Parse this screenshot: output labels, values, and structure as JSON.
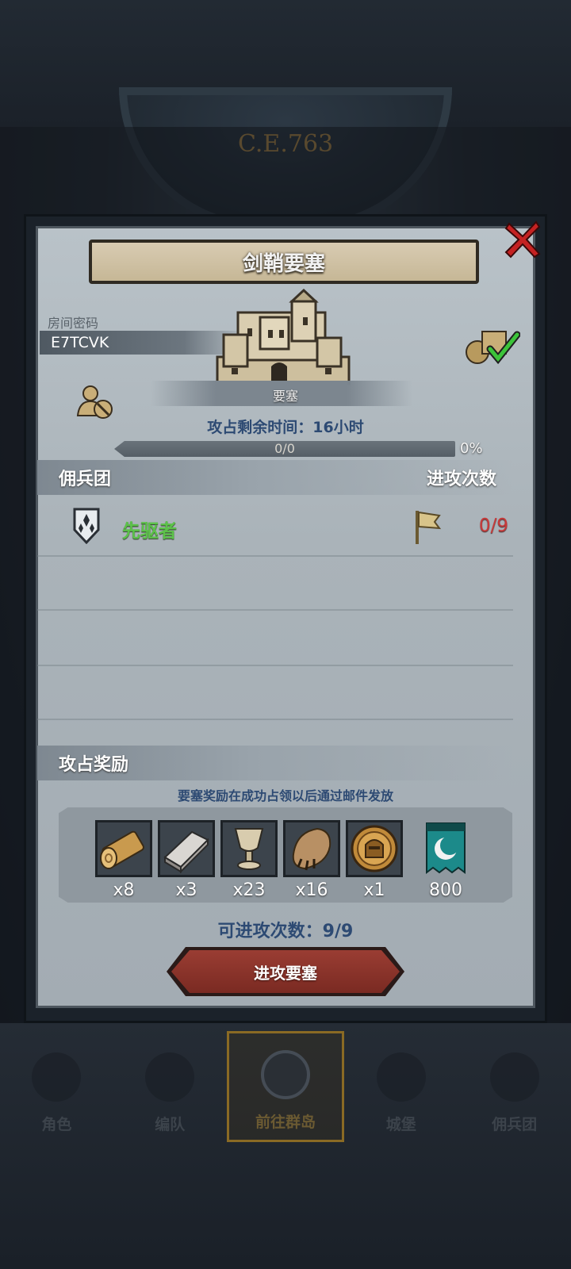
{
  "backdrop": {
    "era": "C.E.763"
  },
  "dialog": {
    "title": "剑鞘要塞",
    "room_label": "房间密码",
    "room_code": "E7TCVK",
    "fortress_label": "要塞",
    "time_left": "攻占剩余时间：16小时",
    "progress": {
      "text": "0/0",
      "percent_label": "0%",
      "fraction": 0
    },
    "mercenary_section": {
      "title": "佣兵团",
      "right_label": "进攻次数"
    },
    "guilds": [
      {
        "name": "先驱者",
        "attacks": "0/9",
        "emblem": "shield-emblem-icon",
        "flag": "flag-icon"
      }
    ],
    "rewards_section": {
      "title": "攻占奖励",
      "note": "要塞奖励在成功占领以后通过邮件发放"
    },
    "rewards": [
      {
        "icon": "wood-log-icon",
        "qty": "x8"
      },
      {
        "icon": "iron-ingot-icon",
        "qty": "x3"
      },
      {
        "icon": "goblet-icon",
        "qty": "x23"
      },
      {
        "icon": "pelt-icon",
        "qty": "x16"
      },
      {
        "icon": "knight-medal-icon",
        "qty": "x1"
      },
      {
        "icon": "guild-banner-icon",
        "qty": "800"
      }
    ],
    "attacks_available": "可进攻次数：9/9",
    "attack_button": "进攻要塞"
  },
  "nav": [
    {
      "label": "角色",
      "icon": "character-icon"
    },
    {
      "label": "编队",
      "icon": "formation-icon"
    },
    {
      "label": "前往群岛",
      "icon": "islands-icon",
      "active": true
    },
    {
      "label": "城堡",
      "icon": "castle-icon"
    },
    {
      "label": "佣兵团",
      "icon": "mercenary-icon"
    }
  ],
  "colors": {
    "guild_name": "#5cc24a",
    "attack_count": "#c73a3a",
    "info_text": "#2d4a73",
    "attack_button": "#8a332a"
  }
}
